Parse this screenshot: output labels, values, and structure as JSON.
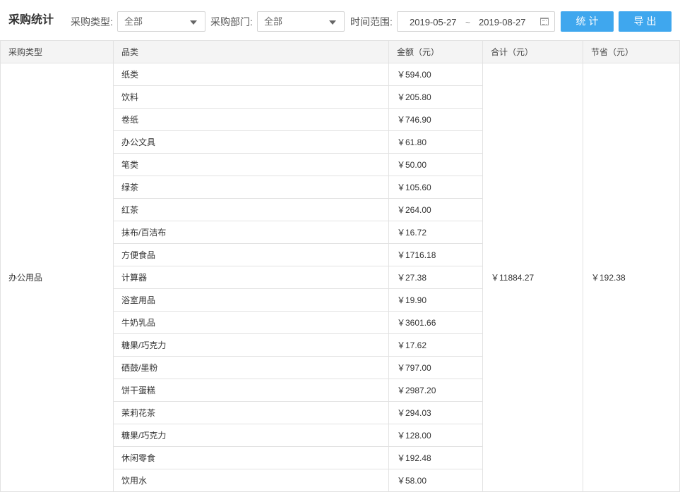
{
  "filter_bar": {
    "title": "采购统计",
    "type_label": "采购类型:",
    "type_value": "全部",
    "dept_label": "采购部门:",
    "dept_value": "全部",
    "date_label": "时间范围:",
    "date_start": "2019-05-27",
    "date_separator": "~",
    "date_end": "2019-08-27",
    "stat_button": "统计",
    "export_button": "导出",
    "button_color": "#3fa7ee"
  },
  "table": {
    "headers": [
      "采购类型",
      "品类",
      "金额（元）",
      "合计（元）",
      "节省（元）"
    ],
    "purchase_type": "办公用品",
    "total": "￥11884.27",
    "saving": "￥192.38",
    "rows": [
      {
        "category": "纸类",
        "amount": "￥594.00"
      },
      {
        "category": "饮料",
        "amount": "￥205.80"
      },
      {
        "category": "卷纸",
        "amount": "￥746.90"
      },
      {
        "category": "办公文具",
        "amount": "￥61.80"
      },
      {
        "category": "笔类",
        "amount": "￥50.00"
      },
      {
        "category": "绿茶",
        "amount": "￥105.60"
      },
      {
        "category": "红茶",
        "amount": "￥264.00"
      },
      {
        "category": "抹布/百洁布",
        "amount": "￥16.72"
      },
      {
        "category": "方便食品",
        "amount": "￥1716.18"
      },
      {
        "category": "计算器",
        "amount": "￥27.38"
      },
      {
        "category": "浴室用品",
        "amount": "￥19.90"
      },
      {
        "category": "牛奶乳品",
        "amount": "￥3601.66"
      },
      {
        "category": "糖果/巧克力",
        "amount": "￥17.62"
      },
      {
        "category": "硒鼓/墨粉",
        "amount": "￥797.00"
      },
      {
        "category": "饼干蛋糕",
        "amount": "￥2987.20"
      },
      {
        "category": "茉莉花茶",
        "amount": "￥294.03"
      },
      {
        "category": "糖果/巧克力",
        "amount": "￥128.00"
      },
      {
        "category": "休闲零食",
        "amount": "￥192.48"
      },
      {
        "category": "饮用水",
        "amount": "￥58.00"
      }
    ]
  }
}
